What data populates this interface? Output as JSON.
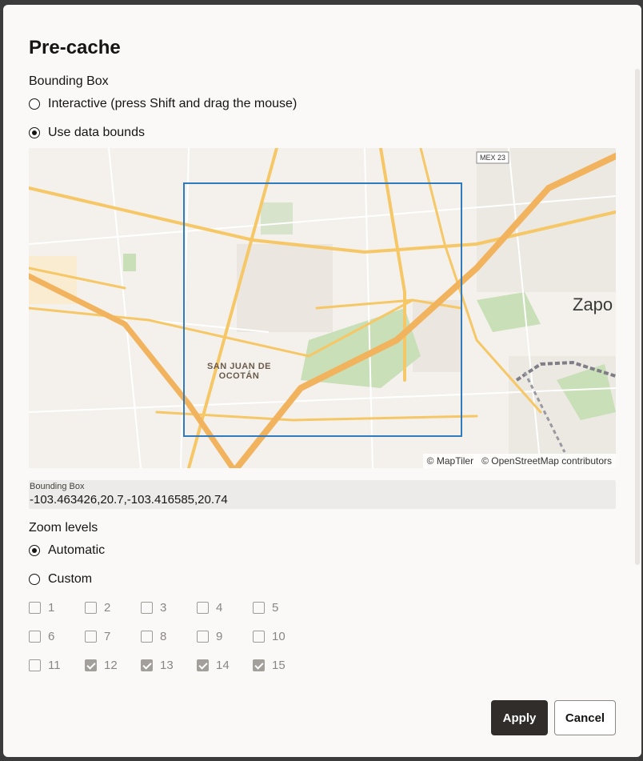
{
  "dialog": {
    "title": "Pre-cache"
  },
  "bounding_box": {
    "section_label": "Bounding Box",
    "options": [
      {
        "label": "Interactive (press Shift and drag the mouse)",
        "checked": false
      },
      {
        "label": "Use data bounds",
        "checked": true
      }
    ],
    "field_label": "Bounding Box",
    "field_value": "-103.463426,20.7,-103.416585,20.74"
  },
  "map": {
    "place_labels": {
      "city": "Zapo",
      "town_line1": "SAN JUAN DE",
      "town_line2": "OCOTÁN",
      "highway_shield": "MEX 23"
    },
    "attribution": [
      "© MapTiler",
      "© OpenStreetMap contributors"
    ],
    "colors": {
      "selection": "#2f7bbd",
      "road": "#f6c766",
      "park": "#c8dfb7",
      "background": "#f4f1ec"
    }
  },
  "zoom": {
    "section_label": "Zoom levels",
    "options": [
      {
        "label": "Automatic",
        "checked": true
      },
      {
        "label": "Custom",
        "checked": false
      }
    ],
    "levels": [
      {
        "label": "1",
        "checked": false
      },
      {
        "label": "2",
        "checked": false
      },
      {
        "label": "3",
        "checked": false
      },
      {
        "label": "4",
        "checked": false
      },
      {
        "label": "5",
        "checked": false
      },
      {
        "label": "6",
        "checked": false
      },
      {
        "label": "7",
        "checked": false
      },
      {
        "label": "8",
        "checked": false
      },
      {
        "label": "9",
        "checked": false
      },
      {
        "label": "10",
        "checked": false
      },
      {
        "label": "11",
        "checked": false
      },
      {
        "label": "12",
        "checked": true
      },
      {
        "label": "13",
        "checked": true
      },
      {
        "label": "14",
        "checked": true
      },
      {
        "label": "15",
        "checked": true
      }
    ]
  },
  "buttons": {
    "apply": "Apply",
    "cancel": "Cancel"
  }
}
